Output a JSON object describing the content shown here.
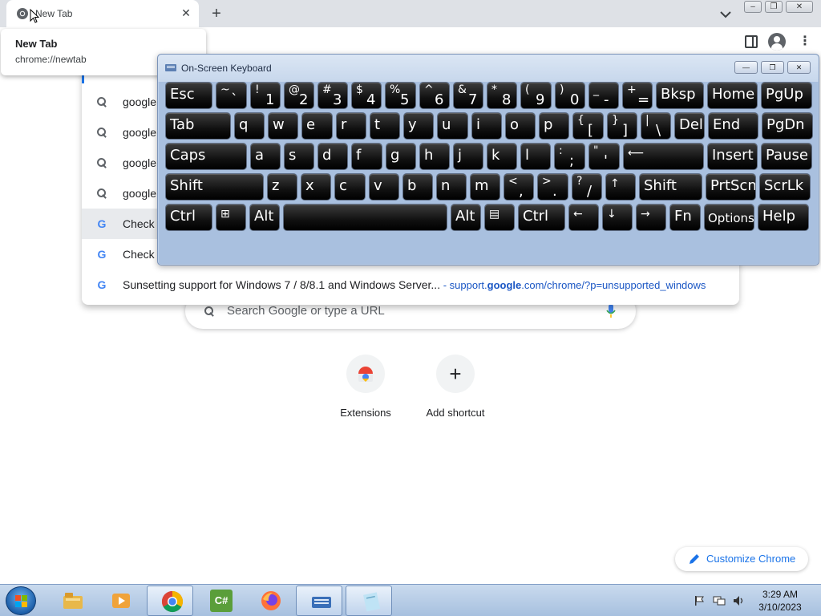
{
  "browser": {
    "tab": {
      "title": "New Tab",
      "close_glyph": "✕"
    },
    "new_tab_glyph": "+",
    "hover_card": {
      "title": "New Tab",
      "url": "chrome://newtab"
    },
    "menu_glyph": "⋮"
  },
  "window_controls": {
    "minimize": "–",
    "maximize": "❐",
    "close": "✕"
  },
  "omnibox_dropdown": {
    "suggestions": [
      {
        "icon": "search-icon",
        "text": "google"
      },
      {
        "icon": "search-icon",
        "text": "google"
      },
      {
        "icon": "search-icon",
        "text": "google"
      },
      {
        "icon": "search-icon",
        "text": "google"
      },
      {
        "icon": "google-icon",
        "text": "Check",
        "selected": true
      },
      {
        "icon": "google-icon",
        "text": "Check"
      },
      {
        "icon": "google-icon",
        "text": "Sunsetting support for Windows 7 / 8/8.1 and Windows Server...",
        "separator": " - ",
        "url_pre": "support.",
        "url_bold": "google",
        "url_post": ".com/chrome/?p=unsupported_windows"
      }
    ]
  },
  "ntp": {
    "search_placeholder": "Search Google or type a URL",
    "shortcuts": [
      {
        "label": "Extensions",
        "icon": "chrome-web-store-icon"
      },
      {
        "label": "Add shortcut",
        "icon": "plus-icon",
        "glyph": "+"
      }
    ],
    "customize_label": "Customize Chrome"
  },
  "osk": {
    "title": "On-Screen Keyboard",
    "title_buttons": {
      "minimize": "—",
      "restore": "❐",
      "close": "✕"
    },
    "rows": [
      [
        {
          "t": "Esc"
        },
        {
          "s": "~",
          "b": "`"
        },
        {
          "s": "!",
          "b": "1"
        },
        {
          "s": "@",
          "b": "2"
        },
        {
          "s": "#",
          "b": "3"
        },
        {
          "s": "$",
          "b": "4"
        },
        {
          "s": "%",
          "b": "5"
        },
        {
          "s": "^",
          "b": "6"
        },
        {
          "s": "&",
          "b": "7"
        },
        {
          "s": "*",
          "b": "8"
        },
        {
          "s": "(",
          "b": "9"
        },
        {
          "s": ")",
          "b": "0"
        },
        {
          "s": "_",
          "b": "-"
        },
        {
          "s": "+",
          "b": "="
        },
        {
          "t": "Bksp"
        },
        {
          "t": "Home"
        },
        {
          "t": "PgUp"
        }
      ],
      [
        {
          "t": "Tab"
        },
        {
          "t": "q"
        },
        {
          "t": "w"
        },
        {
          "t": "e"
        },
        {
          "t": "r"
        },
        {
          "t": "t"
        },
        {
          "t": "y"
        },
        {
          "t": "u"
        },
        {
          "t": "i"
        },
        {
          "t": "o"
        },
        {
          "t": "p"
        },
        {
          "s": "{",
          "b": "["
        },
        {
          "s": "}",
          "b": "]"
        },
        {
          "s": "|",
          "b": "\\"
        },
        {
          "t": "Del"
        },
        {
          "t": "End"
        },
        {
          "t": "PgDn"
        }
      ],
      [
        {
          "t": "Caps"
        },
        {
          "t": "a"
        },
        {
          "t": "s"
        },
        {
          "t": "d"
        },
        {
          "t": "f"
        },
        {
          "t": "g"
        },
        {
          "t": "h"
        },
        {
          "t": "j"
        },
        {
          "t": "k"
        },
        {
          "t": "l"
        },
        {
          "s": ":",
          "b": ";"
        },
        {
          "s": "\"",
          "b": "'"
        },
        {
          "t": "⟵",
          "name": "enter"
        },
        {
          "t": "Insert"
        },
        {
          "t": "Pause"
        }
      ],
      [
        {
          "t": "Shift"
        },
        {
          "t": "z"
        },
        {
          "t": "x"
        },
        {
          "t": "c"
        },
        {
          "t": "v"
        },
        {
          "t": "b"
        },
        {
          "t": "n"
        },
        {
          "t": "m"
        },
        {
          "s": "<",
          "b": ","
        },
        {
          "s": ">",
          "b": "."
        },
        {
          "s": "?",
          "b": "/"
        },
        {
          "t": "↑",
          "name": "up"
        },
        {
          "t": "Shift"
        },
        {
          "t": "PrtScn"
        },
        {
          "t": "ScrLk"
        }
      ],
      [
        {
          "t": "Ctrl"
        },
        {
          "t": "⊞",
          "name": "windows"
        },
        {
          "t": "Alt"
        },
        {
          "t": "",
          "name": "space"
        },
        {
          "t": "Alt"
        },
        {
          "t": "▤",
          "name": "menu"
        },
        {
          "t": "Ctrl"
        },
        {
          "t": "←",
          "name": "left"
        },
        {
          "t": "↓",
          "name": "down"
        },
        {
          "t": "→",
          "name": "right"
        },
        {
          "t": "Fn"
        },
        {
          "t": "Options"
        },
        {
          "t": "Help"
        }
      ]
    ]
  },
  "taskbar": {
    "apps": [
      {
        "name": "windows-explorer-icon"
      },
      {
        "name": "media-player-icon"
      },
      {
        "name": "chrome-icon",
        "active": true
      },
      {
        "name": "csharp-icon",
        "glyph": "C#"
      },
      {
        "name": "firefox-icon"
      },
      {
        "name": "on-screen-keyboard-icon"
      },
      {
        "name": "notepad-icon"
      }
    ],
    "time": "3:29 AM",
    "date": "3/10/2023"
  },
  "colors": {
    "accent_blue": "#1a73e8",
    "link_blue": "#1a56c4",
    "tabstrip": "#dee1e6",
    "osk_frame": "#bccfe8"
  }
}
